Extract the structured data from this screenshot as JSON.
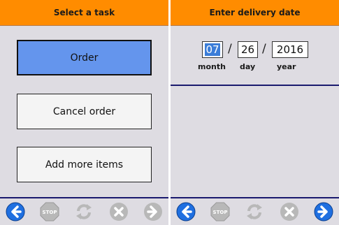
{
  "left_panel": {
    "header": "Select a task",
    "buttons": [
      "Order",
      "Cancel order",
      "Add more items"
    ]
  },
  "right_panel": {
    "header": "Enter delivery date",
    "date": {
      "month": "07",
      "day": "26",
      "year": "2016",
      "separator": "/"
    },
    "labels": {
      "month": "month",
      "day": "day",
      "year": "year"
    }
  },
  "toolbar": {
    "left": {
      "back": {
        "icon": "arrow-left-icon",
        "enabled": true
      },
      "stop": {
        "icon": "stop-icon",
        "label": "STOP",
        "enabled": false
      },
      "refresh": {
        "icon": "refresh-icon",
        "enabled": false
      },
      "cancel": {
        "icon": "cancel-icon",
        "enabled": false
      },
      "forward": {
        "icon": "arrow-right-icon",
        "enabled": false
      }
    },
    "right": {
      "back": {
        "icon": "arrow-left-icon",
        "enabled": true
      },
      "stop": {
        "icon": "stop-icon",
        "label": "STOP",
        "enabled": false
      },
      "refresh": {
        "icon": "refresh-icon",
        "enabled": false
      },
      "cancel": {
        "icon": "cancel-icon",
        "enabled": false
      },
      "forward": {
        "icon": "arrow-right-icon",
        "enabled": true
      }
    }
  },
  "colors": {
    "header": "#ff8c00",
    "panel_bg": "#dedce2",
    "selected_button": "#6495ed",
    "rule": "#1a1a6e",
    "nav_enabled": "#1f6fe0",
    "nav_disabled": "#b8b8b8"
  }
}
